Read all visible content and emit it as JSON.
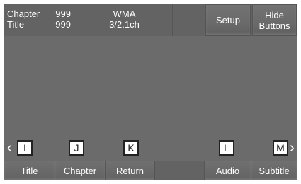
{
  "info": {
    "chapter_label": "Chapter",
    "chapter_value": "999",
    "title_label": "Title",
    "title_value": "999"
  },
  "audio_format": {
    "codec": "WMA",
    "channels": "3/2.1ch"
  },
  "top_buttons": {
    "setup": "Setup",
    "hide_line1": "Hide",
    "hide_line2": "Buttons"
  },
  "keys": {
    "i": "I",
    "j": "J",
    "k": "K",
    "l": "L",
    "m": "M",
    "prev_arrow": "‹",
    "next_arrow": "›"
  },
  "bottom_buttons": {
    "title": "Title",
    "chapter": "Chapter",
    "return": "Return",
    "audio": "Audio",
    "subtitle": "Subtitle"
  }
}
